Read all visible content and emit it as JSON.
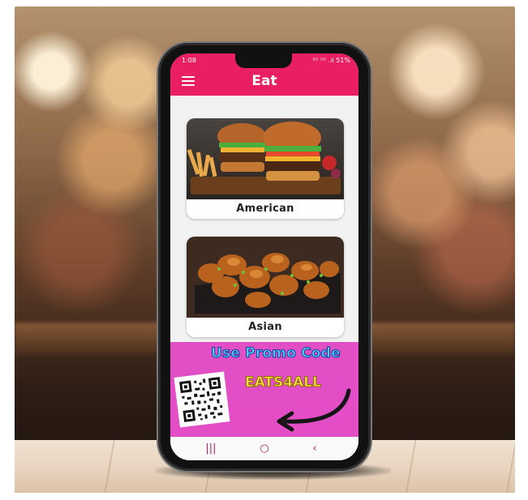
{
  "status_bar": {
    "time": "1:08",
    "right": "⁵ᴳ ⁵ᴳ .ıl 51%"
  },
  "app_bar": {
    "title": "Eat"
  },
  "categories": [
    {
      "label": "American"
    },
    {
      "label": "Asian"
    }
  ],
  "promo": {
    "line1": "Use Promo Code",
    "code": "EATS4ALL"
  },
  "nav_bar": {
    "recent": "|||",
    "home": "○",
    "back": "‹"
  },
  "colors": {
    "primary": "#e91e63",
    "promo_bg": "#e24fc4",
    "promo_text_blue": "#4fd0ff",
    "promo_text_yellow": "#ffe53b"
  },
  "icons": {
    "menu": "hamburger-menu-icon",
    "qr": "qr-code",
    "arrow": "curved-arrow-icon"
  }
}
